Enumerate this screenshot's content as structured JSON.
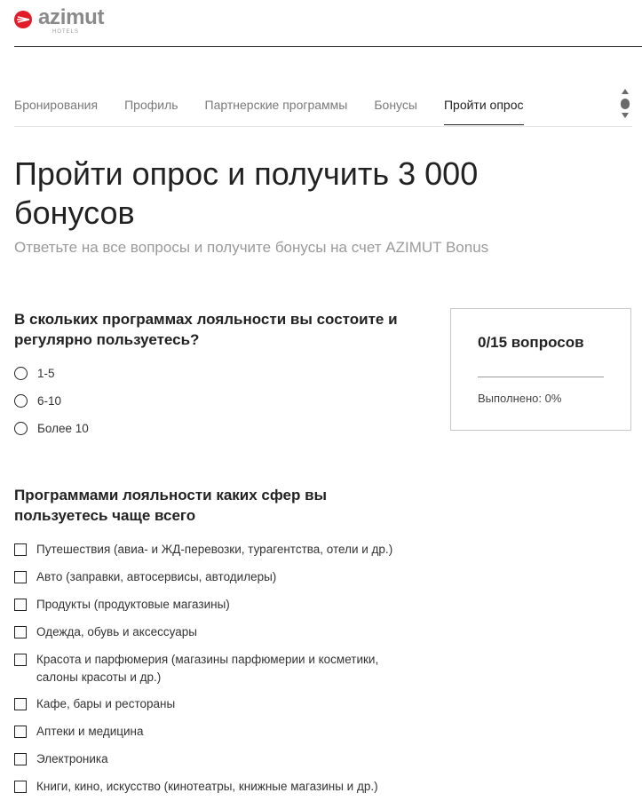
{
  "brand": {
    "name": "azimut",
    "sub": "HOTELS",
    "color": "#e11d2a"
  },
  "nav": {
    "items": [
      {
        "label": "Бронирования"
      },
      {
        "label": "Профиль"
      },
      {
        "label": "Партнерские программы"
      },
      {
        "label": "Бонусы"
      },
      {
        "label": "Пройти опрос",
        "active": true
      }
    ]
  },
  "page": {
    "title": "Пройти опрос и получить 3 000 бонусов",
    "subtitle": "Ответьте на все вопросы и получите бонусы на счет AZIMUT Bonus"
  },
  "progress": {
    "count": "0/15 вопросов",
    "done": "Выполнено: 0%",
    "percent": 0
  },
  "questions": [
    {
      "text": "В скольких программах лояльности вы состоите и регулярно пользуетесь?",
      "type": "radio",
      "options": [
        "1-5",
        "6-10",
        "Более 10"
      ]
    },
    {
      "text": "Программами лояльности каких сфер вы пользуетесь чаще всего",
      "type": "checkbox",
      "options": [
        "Путешествия (авиа- и ЖД-перевозки, турагентства, отели и др.)",
        "Авто (заправки, автосервисы, автодилеры)",
        "Продукты (продуктовые магазины)",
        "Одежда, обувь и аксессуары",
        "Красота и парфюмерия (магазины парфюмерии и косметики, салоны красоты и др.)",
        "Кафе, бары и рестораны",
        "Аптеки и медицина",
        "Электроника",
        "Книги, кино, искусство (кинотеатры, книжные магазины и др.)"
      ]
    }
  ],
  "icons": {
    "logo": "azimut-logo-icon",
    "scroll": "scroll-indicator-icon"
  }
}
